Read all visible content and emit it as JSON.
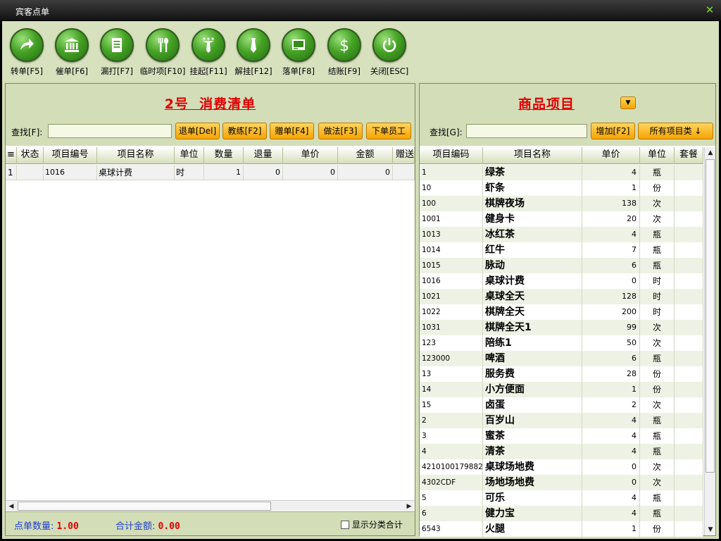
{
  "window": {
    "title": "宾客点单"
  },
  "toolbar": [
    {
      "label": "转单[F5]",
      "icon": "transfer-icon"
    },
    {
      "label": "催单[F6]",
      "icon": "bank-icon"
    },
    {
      "label": "漏打[F7]",
      "icon": "document-icon"
    },
    {
      "label": "临时项[F10]",
      "icon": "fork-spoon-icon"
    },
    {
      "label": "挂起[F11]",
      "icon": "tie-icon"
    },
    {
      "label": "解挂[F12]",
      "icon": "tie-icon"
    },
    {
      "label": "落单[F8]",
      "icon": "picture-icon"
    },
    {
      "label": "结账[F9]",
      "icon": "dollar-icon"
    },
    {
      "label": "关闭[ESC]",
      "icon": "power-icon"
    }
  ],
  "left": {
    "title": "2号  消费清单",
    "search_label": "查找[F]:",
    "search_value": "",
    "buttons": [
      "退单[Del]",
      "教练[F2]",
      "赠单[F4]",
      "做法[F3]",
      "下单员工"
    ],
    "columns": [
      "≡",
      "状态",
      "项目编号",
      "项目名称",
      "单位",
      "数量",
      "退量",
      "单价",
      "金额",
      "赠送"
    ],
    "rows": [
      {
        "idx": "1",
        "status": "",
        "code": "1016",
        "name": "桌球计费",
        "unit": "时",
        "qty": "1",
        "ret": "0",
        "price": "0",
        "amount": "0",
        "gift": ""
      }
    ],
    "footer": {
      "count_label": "点单数量:",
      "count_value": "1.00",
      "total_label": "合计金额:",
      "total_value": "0.00",
      "show_category_label": "显示分类合计"
    }
  },
  "right": {
    "title": "商品项目",
    "search_label": "查找[G]:",
    "search_value": "",
    "add_button": "增加[F2]",
    "category_button": "所有项目类 ↓",
    "columns": [
      "项目编码",
      "项目名称",
      "单价",
      "单位",
      "套餐"
    ],
    "rows": [
      {
        "code": "1",
        "name": "绿茶",
        "price": "4",
        "unit": "瓶"
      },
      {
        "code": "10",
        "name": "虾条",
        "price": "1",
        "unit": "份"
      },
      {
        "code": "100",
        "name": "棋牌夜场",
        "price": "138",
        "unit": "次"
      },
      {
        "code": "1001",
        "name": "健身卡",
        "price": "20",
        "unit": "次"
      },
      {
        "code": "1013",
        "name": "冰红茶",
        "price": "4",
        "unit": "瓶"
      },
      {
        "code": "1014",
        "name": "红牛",
        "price": "7",
        "unit": "瓶"
      },
      {
        "code": "1015",
        "name": "脉动",
        "price": "6",
        "unit": "瓶"
      },
      {
        "code": "1016",
        "name": "桌球计费",
        "price": "0",
        "unit": "时"
      },
      {
        "code": "1021",
        "name": "桌球全天",
        "price": "128",
        "unit": "时"
      },
      {
        "code": "1022",
        "name": "棋牌全天",
        "price": "200",
        "unit": "时"
      },
      {
        "code": "1031",
        "name": "棋牌全天1",
        "price": "99",
        "unit": "次"
      },
      {
        "code": "123",
        "name": "陪练1",
        "price": "50",
        "unit": "次"
      },
      {
        "code": "123000",
        "name": "啤酒",
        "price": "6",
        "unit": "瓶"
      },
      {
        "code": "13",
        "name": "服务费",
        "price": "28",
        "unit": "份"
      },
      {
        "code": "14",
        "name": "小方便面",
        "price": "1",
        "unit": "份"
      },
      {
        "code": "15",
        "name": "卤蛋",
        "price": "2",
        "unit": "次"
      },
      {
        "code": "2",
        "name": "百岁山",
        "price": "4",
        "unit": "瓶"
      },
      {
        "code": "3",
        "name": "蜜茶",
        "price": "4",
        "unit": "瓶"
      },
      {
        "code": "4",
        "name": "清茶",
        "price": "4",
        "unit": "瓶"
      },
      {
        "code": "4210100179882",
        "name": "桌球场地费",
        "price": "0",
        "unit": "次"
      },
      {
        "code": "4302CDF",
        "name": "场地场地费",
        "price": "0",
        "unit": "次"
      },
      {
        "code": "5",
        "name": "可乐",
        "price": "4",
        "unit": "瓶"
      },
      {
        "code": "6",
        "name": "健力宝",
        "price": "4",
        "unit": "瓶"
      },
      {
        "code": "6543",
        "name": "火腿",
        "price": "1",
        "unit": "份"
      }
    ]
  }
}
